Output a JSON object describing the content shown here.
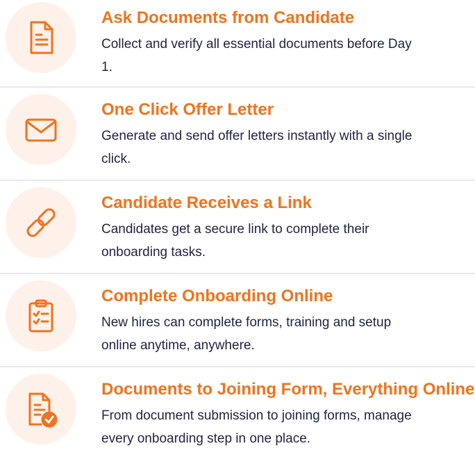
{
  "colors": {
    "accent": "#f0731d",
    "icon_background": "#fdf1ea",
    "body_text": "#1f2340",
    "divider": "#e8e9ee"
  },
  "features": [
    {
      "icon": "document-icon",
      "title": "Ask Documents from Candidate",
      "description": "Collect and verify all essential documents before Day 1."
    },
    {
      "icon": "envelope-icon",
      "title": "One Click Offer Letter",
      "description": "Generate and send offer letters instantly with a single click."
    },
    {
      "icon": "link-icon",
      "title": "Candidate Receives a Link",
      "description": "Candidates get a secure link to complete their onboarding tasks."
    },
    {
      "icon": "clipboard-checklist-icon",
      "title": "Complete Onboarding Online",
      "description": "New hires can complete forms, training and setup online anytime, anywhere."
    },
    {
      "icon": "document-check-icon",
      "title": "Documents to Joining Form, Everything Online",
      "description": "From document submission to joining forms, manage every onboarding step in one place."
    }
  ]
}
